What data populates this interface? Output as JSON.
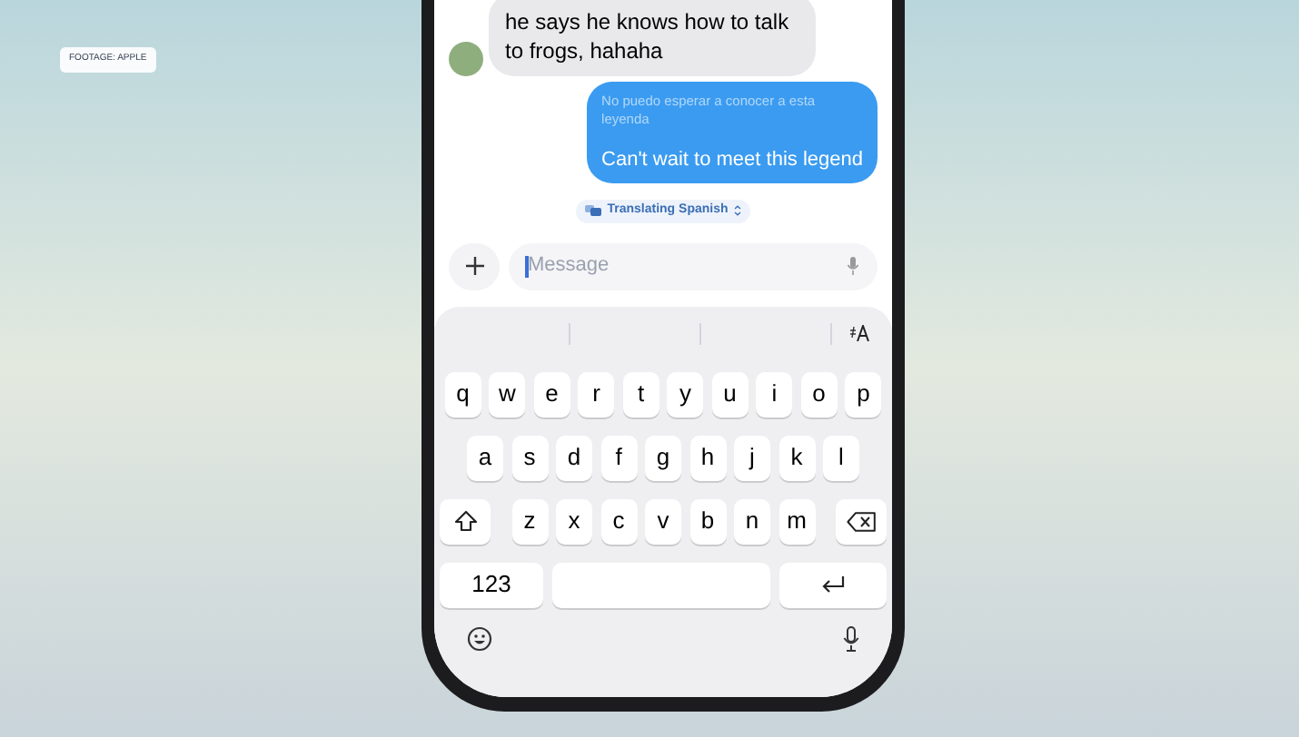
{
  "badge": "FOOTAGE: APPLE",
  "messages": [
    {
      "kind": "incoming",
      "text": "he says he knows how to talk to frogs, hahaha"
    },
    {
      "kind": "outgoing",
      "translation": "No puedo esperar a conocer a esta leyenda",
      "text": "Can't wait to meet this legend"
    }
  ],
  "translation_pill": {
    "label": "Translating Spanish"
  },
  "composer": {
    "placeholder": "Message"
  },
  "keyboard": {
    "rows": [
      [
        "q",
        "w",
        "e",
        "r",
        "t",
        "y",
        "u",
        "i",
        "o",
        "p"
      ],
      [
        "a",
        "s",
        "d",
        "f",
        "g",
        "h",
        "j",
        "k",
        "l"
      ],
      [
        "z",
        "x",
        "c",
        "v",
        "b",
        "n",
        "m"
      ]
    ],
    "numbers_key": "123"
  }
}
